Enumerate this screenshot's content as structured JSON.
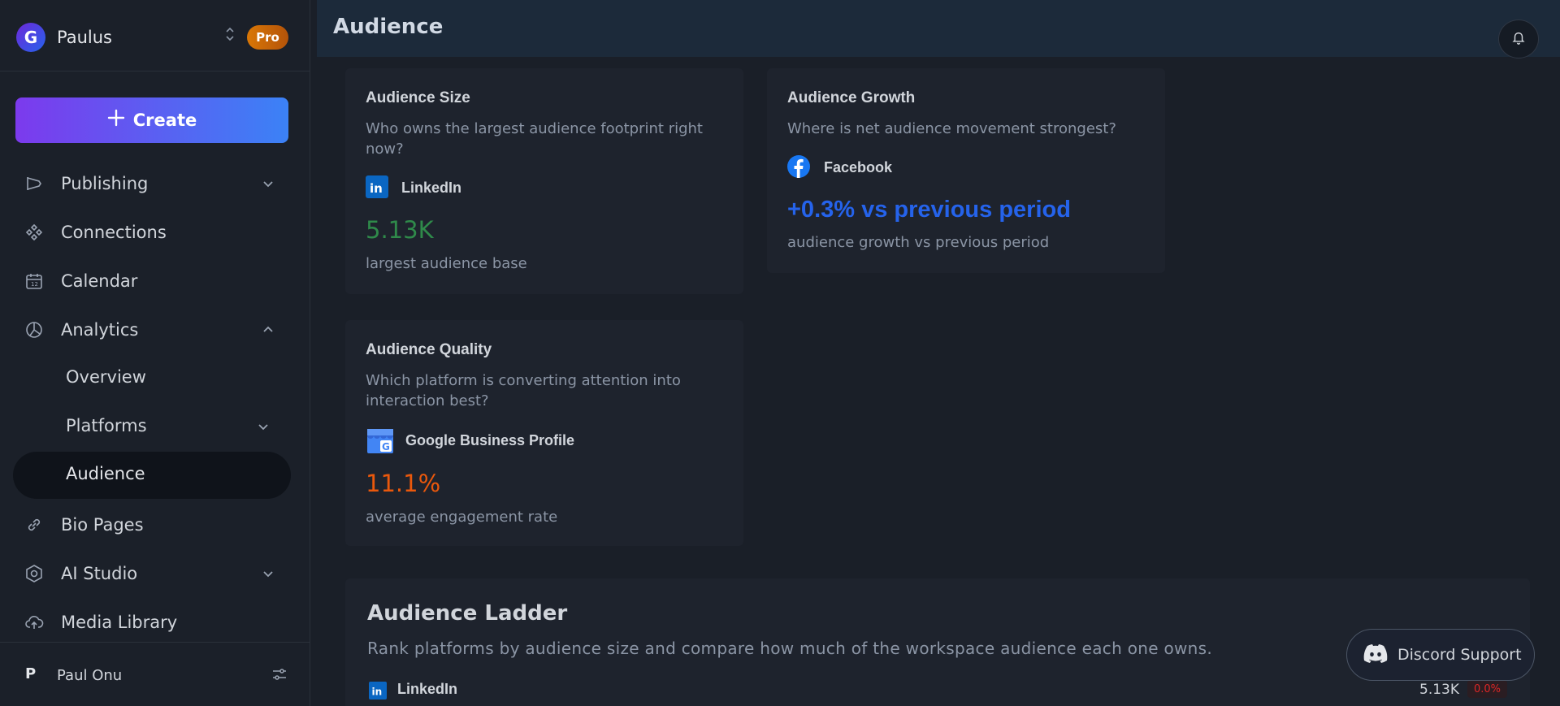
{
  "workspace": {
    "name": "Paulus",
    "badge": "Pro",
    "logo_letter": "G"
  },
  "sidebar": {
    "create_label": "Create",
    "items": [
      {
        "label": "Publishing",
        "icon": "megaphone-icon",
        "chevron": "down"
      },
      {
        "label": "Connections",
        "icon": "connections-icon"
      },
      {
        "label": "Calendar",
        "icon": "calendar-icon"
      },
      {
        "label": "Analytics",
        "icon": "pie-chart-icon",
        "chevron": "up"
      },
      {
        "label": "Overview"
      },
      {
        "label": "Platforms",
        "chevron": "down"
      },
      {
        "label": "Audience",
        "active": true
      },
      {
        "label": "Bio Pages",
        "icon": "link-icon"
      },
      {
        "label": "AI Studio",
        "icon": "ai-hex-icon",
        "chevron": "down"
      },
      {
        "label": "Media Library",
        "icon": "cloud-upload-icon"
      }
    ]
  },
  "user": {
    "initial": "P",
    "name": "Paul Onu"
  },
  "header": {
    "title": "Audience"
  },
  "cards": {
    "size": {
      "title": "Audience Size",
      "question": "Who owns the largest audience footprint right now?",
      "platform": "LinkedIn",
      "metric": "5.13K",
      "metric_color": "#2f8a4a",
      "caption": "largest audience base"
    },
    "growth": {
      "title": "Audience Growth",
      "question": "Where is net audience movement strongest?",
      "platform": "Facebook",
      "metric": "+0.3% vs previous period",
      "metric_color": "#2563eb",
      "caption": "audience growth vs previous period"
    },
    "quality": {
      "title": "Audience Quality",
      "question": "Which platform is converting attention into interaction best?",
      "platform": "Google Business Profile",
      "metric": "11.1%",
      "metric_color": "#ea580c",
      "caption": "average engagement rate"
    }
  },
  "ladder": {
    "title": "Audience Ladder",
    "description": "Rank platforms by audience size and compare how much of the workspace audience each one owns.",
    "rows": [
      {
        "platform": "LinkedIn",
        "value": "5.13K",
        "change": "0.0%"
      }
    ]
  },
  "support": {
    "label": "Discord Support"
  },
  "colors": {
    "accent_gradient_start": "#7c3aed",
    "accent_gradient_end": "#3b82f6",
    "linkedin": "#0a66c2",
    "facebook": "#1877f2",
    "negative": "#dc2626"
  }
}
